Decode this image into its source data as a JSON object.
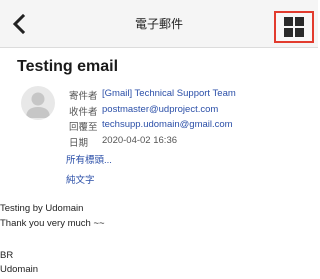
{
  "header": {
    "title": "電子郵件"
  },
  "email": {
    "subject": "Testing email",
    "fields": [
      {
        "label": "寄件者",
        "value": "[Gmail] Technical Support Team"
      },
      {
        "label": "收件者",
        "value": "postmaster@udproject.com"
      },
      {
        "label": "回覆至",
        "value": "techsupp.udomain@gmail.com"
      },
      {
        "label": "日期",
        "value": "2020-04-02 16:36"
      }
    ],
    "all_headers_link": "所有標頭...",
    "plain_text_link": "純文字",
    "body_lines": [
      "Testing by Udomain",
      "Thank you very much ~~",
      "",
      "BR",
      "Udomain"
    ]
  },
  "colors": {
    "link": "#2b4fa8",
    "highlight_border": "#e23b2e"
  }
}
